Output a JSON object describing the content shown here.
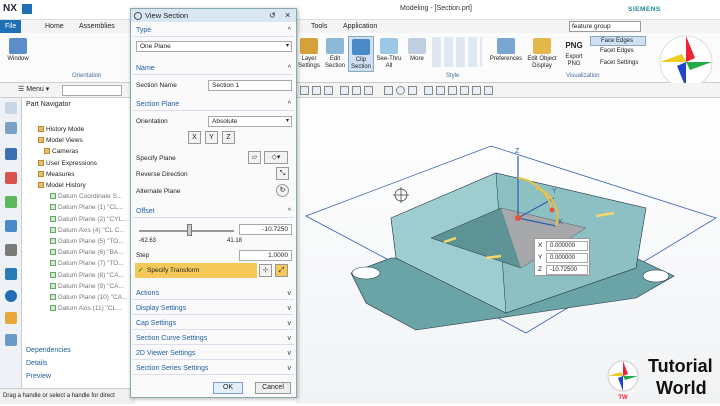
{
  "app": {
    "logo": "NX",
    "title": "Modeling - [Section.prt]",
    "brand": "SIEMENS",
    "search_value": "feature group"
  },
  "tabs": [
    "File",
    "Home",
    "Assemblies",
    "Tools",
    "Application"
  ],
  "ribbon": {
    "window_label": "Window",
    "orientation_label": "Orientation",
    "add_layer": "Layer Settings",
    "edit_section": "Edit Section",
    "clip_section": "Clip Section",
    "see_thru": "See-Thru All",
    "more": "More",
    "style_label": "Style",
    "preferences": "Preferences",
    "edit_object_display": "Edit Object Display",
    "export_png": "Export PNG",
    "png": "PNG",
    "face_edges": "Face Edges",
    "facet_edges": "Facet Edges",
    "facet_settings": "Facet Settings",
    "visualization_label": "Visualization"
  },
  "menu_label": "Menu",
  "navigator": {
    "title": "Part Navigator",
    "items": [
      {
        "label": "History Mode",
        "grey": false
      },
      {
        "label": "Model Views",
        "grey": false
      },
      {
        "label": "Cameras",
        "grey": false
      },
      {
        "label": "User Expressions",
        "grey": false
      },
      {
        "label": "Measures",
        "grey": false
      },
      {
        "label": "Model History",
        "grey": false
      },
      {
        "label": "Datum Coordinate S...",
        "grey": true
      },
      {
        "label": "Datum Plane (1) \"CL...",
        "grey": true
      },
      {
        "label": "Datum Plane (2) \"CYL...",
        "grey": true
      },
      {
        "label": "Datum Axis (4) \"CL C...",
        "grey": true
      },
      {
        "label": "Datum Plane (5) \"TO...",
        "grey": true
      },
      {
        "label": "Datum Plane (6) \"BA...",
        "grey": true
      },
      {
        "label": "Datum Plane (7) \"TO...",
        "grey": true
      },
      {
        "label": "Datum Plane (8) \"CA...",
        "grey": true
      },
      {
        "label": "Datum Plane (9) \"CA...",
        "grey": true
      },
      {
        "label": "Datum Plane (10) \"CA...",
        "grey": true
      },
      {
        "label": "Datum Axis (11) \"CL...",
        "grey": true
      }
    ],
    "footer": [
      "Dependencies",
      "Details",
      "Preview"
    ]
  },
  "status": "Drag a handle or select a handle for direct",
  "dialog": {
    "title": "View Section",
    "type_section": "Type",
    "type_value": "One Plane",
    "name_section": "Name",
    "section_name_label": "Section Name",
    "section_name_value": "Section 1",
    "plane_section": "Section Plane",
    "orientation_label": "Orientation",
    "orientation_value": "Absolute",
    "specify_plane": "Specify Plane",
    "reverse_direction": "Reverse Direction",
    "alternate_plane": "Alternate Plane",
    "offset_section": "Offset",
    "offset_value": "-10.7250",
    "slider_min": "-62.63",
    "slider_max": "41.18",
    "step_label": "Step",
    "step_value": "1.0000",
    "specify_transform": "Specify Transform",
    "collapsed": [
      "Actions",
      "Display Settings",
      "Cap Settings",
      "Section Curve Settings",
      "2D Viewer Settings",
      "Section Series Settings"
    ],
    "ok": "OK",
    "cancel": "Cancel"
  },
  "coords": {
    "x": "0.000000",
    "y": "0.000000",
    "z": "-10.72500"
  },
  "axes": {
    "x": "X",
    "y": "Y",
    "z": "Z"
  },
  "logo_tw": "TW",
  "watermark": {
    "line1": "Tutorial",
    "line2": "World",
    "tw": "TW"
  },
  "colors": {
    "accent": "#1f6fb5",
    "model": "#7fb3b5",
    "highlight": "#f5d76e"
  }
}
